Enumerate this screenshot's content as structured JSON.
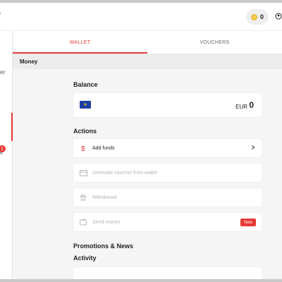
{
  "topbar": {
    "edge_text": "r",
    "coins": "0"
  },
  "sidebar": {
    "fragments": [
      "er",
      "k"
    ],
    "notification_count": "1"
  },
  "tabs": [
    {
      "label": "WALLET",
      "active": true
    },
    {
      "label": "VOUCHERS",
      "active": false
    }
  ],
  "section_title": "Money",
  "balance": {
    "heading": "Balance",
    "currency": "EUR",
    "amount": "0"
  },
  "actions": {
    "heading": "Actions",
    "items": [
      {
        "label": "Add funds",
        "icon": "dollar-icon",
        "enabled": true
      },
      {
        "label": "Generate voucher from wallet",
        "icon": "card-icon",
        "enabled": false
      },
      {
        "label": "Withdrawal",
        "icon": "bank-icon",
        "enabled": false
      },
      {
        "label": "Send money",
        "icon": "wallet-icon",
        "enabled": false,
        "badge": "New"
      }
    ]
  },
  "promotions_heading": "Promotions & News",
  "activity_heading": "Activity",
  "colors": {
    "accent": "#e53935",
    "background": "#f5f5f5"
  }
}
